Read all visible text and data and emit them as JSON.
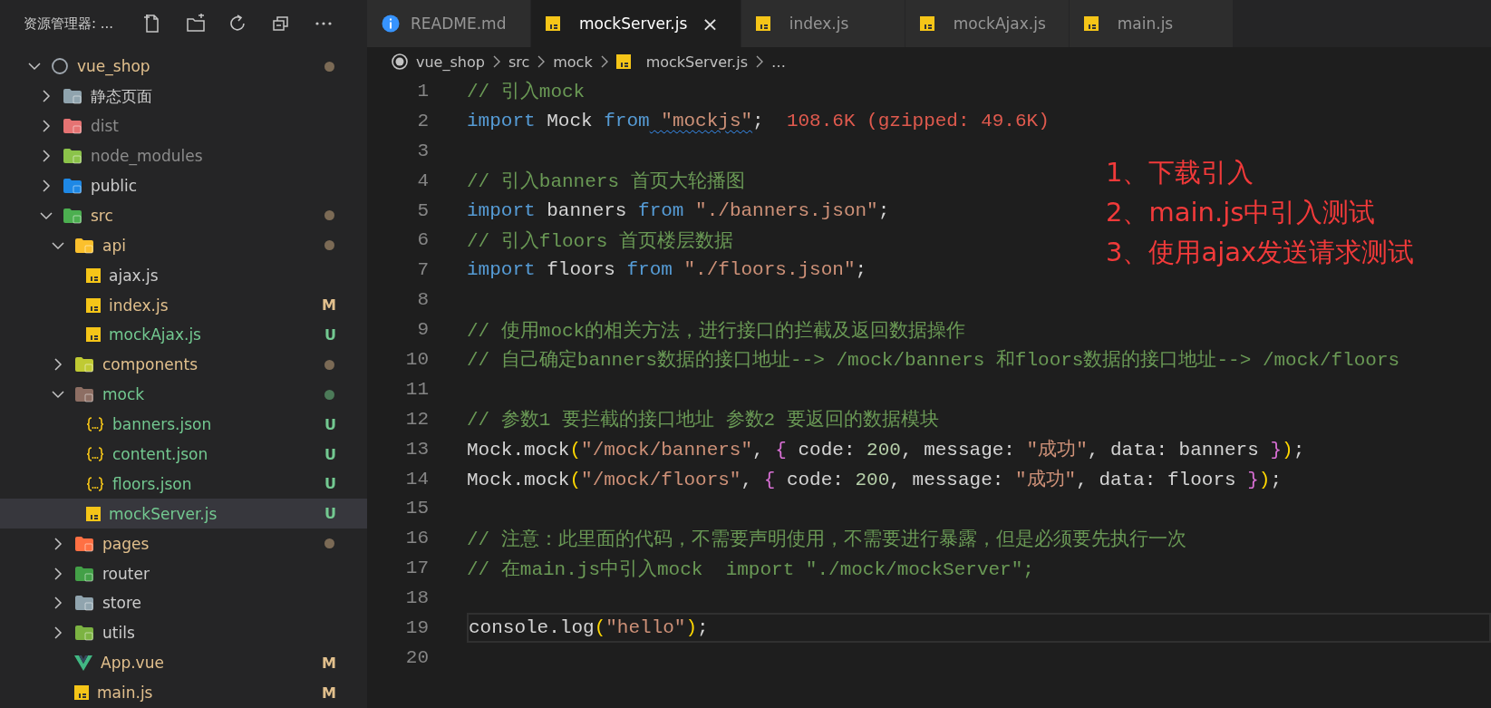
{
  "sidebar": {
    "title": "资源管理器: ...",
    "tree": [
      {
        "name": "vue_shop",
        "kind": "repo",
        "expanded": true,
        "selected": false,
        "modified": true,
        "untracked": false,
        "ignored": false,
        "children": [
          {
            "name": "静态页面",
            "kind": "folder",
            "color": "#90a4ae",
            "expanded": false,
            "selected": false,
            "modified": false,
            "untracked": false,
            "ignored": false
          },
          {
            "name": "dist",
            "kind": "folder",
            "color": "#e57373",
            "expanded": false,
            "selected": false,
            "modified": false,
            "untracked": false,
            "ignored": true
          },
          {
            "name": "node_modules",
            "kind": "folder",
            "color": "#8bc34a",
            "expanded": false,
            "selected": false,
            "modified": false,
            "untracked": false,
            "ignored": true
          },
          {
            "name": "public",
            "kind": "folder",
            "color": "#1e88e5",
            "expanded": false,
            "selected": false,
            "modified": false,
            "untracked": false,
            "ignored": false
          },
          {
            "name": "src",
            "kind": "folder",
            "color": "#4caf50",
            "expanded": true,
            "selected": false,
            "modified": true,
            "untracked": false,
            "ignored": false,
            "children": [
              {
                "name": "api",
                "kind": "folder",
                "color": "#fbc02d",
                "expanded": true,
                "selected": false,
                "modified": true,
                "untracked": false,
                "ignored": false,
                "children": [
                  {
                    "name": "ajax.js",
                    "kind": "js",
                    "selected": false,
                    "modified": false,
                    "untracked": false,
                    "ignored": false
                  },
                  {
                    "name": "index.js",
                    "kind": "js",
                    "selected": false,
                    "modified": true,
                    "untracked": false,
                    "ignored": false,
                    "badge": "M"
                  },
                  {
                    "name": "mockAjax.js",
                    "kind": "js",
                    "selected": false,
                    "modified": false,
                    "untracked": true,
                    "ignored": false,
                    "badge": "U"
                  }
                ]
              },
              {
                "name": "components",
                "kind": "folder",
                "color": "#c0ca33",
                "expanded": false,
                "selected": false,
                "modified": true,
                "untracked": false,
                "ignored": false
              },
              {
                "name": "mock",
                "kind": "folder",
                "color": "#8d6e63",
                "expanded": true,
                "selected": false,
                "modified": false,
                "untracked": true,
                "ignored": false,
                "children": [
                  {
                    "name": "banners.json",
                    "kind": "json",
                    "selected": false,
                    "modified": false,
                    "untracked": true,
                    "ignored": false,
                    "badge": "U"
                  },
                  {
                    "name": "content.json",
                    "kind": "json",
                    "selected": false,
                    "modified": false,
                    "untracked": true,
                    "ignored": false,
                    "badge": "U"
                  },
                  {
                    "name": "floors.json",
                    "kind": "json",
                    "selected": false,
                    "modified": false,
                    "untracked": true,
                    "ignored": false,
                    "badge": "U"
                  },
                  {
                    "name": "mockServer.js",
                    "kind": "js",
                    "selected": true,
                    "modified": false,
                    "untracked": true,
                    "ignored": false,
                    "badge": "U"
                  }
                ]
              },
              {
                "name": "pages",
                "kind": "folder",
                "color": "#ff7043",
                "expanded": false,
                "selected": false,
                "modified": true,
                "untracked": false,
                "ignored": false
              },
              {
                "name": "router",
                "kind": "folder",
                "color": "#43a047",
                "expanded": false,
                "selected": false,
                "modified": false,
                "untracked": false,
                "ignored": false
              },
              {
                "name": "store",
                "kind": "folder",
                "color": "#90a4ae",
                "expanded": false,
                "selected": false,
                "modified": false,
                "untracked": false,
                "ignored": false
              },
              {
                "name": "utils",
                "kind": "folder",
                "color": "#7cb342",
                "expanded": false,
                "selected": false,
                "modified": false,
                "untracked": false,
                "ignored": false
              },
              {
                "name": "App.vue",
                "kind": "vue",
                "selected": false,
                "modified": true,
                "untracked": false,
                "ignored": false,
                "badge": "M"
              },
              {
                "name": "main.js",
                "kind": "js",
                "selected": false,
                "modified": true,
                "untracked": false,
                "ignored": false,
                "badge": "M"
              }
            ]
          }
        ]
      }
    ]
  },
  "tabs": [
    {
      "label": "README.md",
      "kind": "info",
      "selected": false
    },
    {
      "label": "mockServer.js",
      "kind": "js",
      "selected": true,
      "close": "×"
    },
    {
      "label": "index.js",
      "kind": "js",
      "selected": false
    },
    {
      "label": "mockAjax.js",
      "kind": "js",
      "selected": false
    },
    {
      "label": "main.js",
      "kind": "js",
      "selected": false
    }
  ],
  "breadcrumb": [
    {
      "label": "vue_shop",
      "kind": "repo"
    },
    {
      "label": "src",
      "kind": "folder"
    },
    {
      "label": "mock",
      "kind": "folder"
    },
    {
      "label": "mockServer.js",
      "kind": "js"
    },
    {
      "label": "…",
      "kind": "more"
    }
  ],
  "code": [
    {
      "number": "1",
      "tokens": [
        {
          "text": "// 引入mock",
          "kind": "comment"
        }
      ]
    },
    {
      "number": "2",
      "tokens": [
        {
          "text": "import",
          "kind": "keyword"
        },
        {
          "text": " Mock ",
          "kind": "plain"
        },
        {
          "text": "from",
          "kind": "keyword"
        },
        {
          "text": " \"mockjs\"",
          "kind": "string",
          "squiggle": true
        },
        {
          "text": ";",
          "kind": "plain"
        },
        {
          "text": "  108.6K (gzipped: 49.6K)",
          "kind": "hint"
        }
      ]
    },
    {
      "number": "3"
    },
    {
      "number": "4",
      "tokens": [
        {
          "text": "// 引入banners 首页大轮播图",
          "kind": "comment"
        }
      ]
    },
    {
      "number": "5",
      "tokens": [
        {
          "text": "import",
          "kind": "keyword"
        },
        {
          "text": " banners ",
          "kind": "plain"
        },
        {
          "text": "from",
          "kind": "keyword"
        },
        {
          "text": " \"./banners.json\"",
          "kind": "string"
        },
        {
          "text": ";",
          "kind": "plain"
        }
      ]
    },
    {
      "number": "6",
      "tokens": [
        {
          "text": "// 引入floors 首页楼层数据",
          "kind": "comment"
        }
      ]
    },
    {
      "number": "7",
      "tokens": [
        {
          "text": "import",
          "kind": "keyword"
        },
        {
          "text": " floors ",
          "kind": "plain"
        },
        {
          "text": "from",
          "kind": "keyword"
        },
        {
          "text": " \"./floors.json\"",
          "kind": "string"
        },
        {
          "text": ";",
          "kind": "plain"
        }
      ]
    },
    {
      "number": "8"
    },
    {
      "number": "9",
      "tokens": [
        {
          "text": "// 使用mock的相关方法，进行接口的拦截及返回数据操作",
          "kind": "comment"
        }
      ]
    },
    {
      "number": "10",
      "tokens": [
        {
          "text": "// 自己确定banners数据的接口地址--> /mock/banners 和floors数据的接口地址--> /mock/floors",
          "kind": "comment"
        }
      ]
    },
    {
      "number": "11"
    },
    {
      "number": "12",
      "tokens": [
        {
          "text": "// 参数1 要拦截的接口地址 参数2 要返回的数据模块",
          "kind": "comment"
        }
      ]
    },
    {
      "number": "13",
      "tokens": [
        {
          "text": "Mock.mock",
          "kind": "plain"
        },
        {
          "text": "(",
          "kind": "bracket"
        },
        {
          "text": "\"/mock/banners\"",
          "kind": "string"
        },
        {
          "text": ", ",
          "kind": "plain"
        },
        {
          "text": "{",
          "kind": "brace"
        },
        {
          "text": " code: ",
          "kind": "plain"
        },
        {
          "text": "200",
          "kind": "number"
        },
        {
          "text": ", message: ",
          "kind": "plain"
        },
        {
          "text": "\"成功\"",
          "kind": "string"
        },
        {
          "text": ", data: banners ",
          "kind": "plain"
        },
        {
          "text": "}",
          "kind": "brace"
        },
        {
          "text": ")",
          "kind": "bracket"
        },
        {
          "text": ";",
          "kind": "plain"
        }
      ]
    },
    {
      "number": "14",
      "tokens": [
        {
          "text": "Mock.mock",
          "kind": "plain"
        },
        {
          "text": "(",
          "kind": "bracket"
        },
        {
          "text": "\"/mock/floors\"",
          "kind": "string"
        },
        {
          "text": ", ",
          "kind": "plain"
        },
        {
          "text": "{",
          "kind": "brace"
        },
        {
          "text": " code: ",
          "kind": "plain"
        },
        {
          "text": "200",
          "kind": "number"
        },
        {
          "text": ", message: ",
          "kind": "plain"
        },
        {
          "text": "\"成功\"",
          "kind": "string"
        },
        {
          "text": ", data: floors ",
          "kind": "plain"
        },
        {
          "text": "}",
          "kind": "brace"
        },
        {
          "text": ")",
          "kind": "bracket"
        },
        {
          "text": ";",
          "kind": "plain"
        }
      ]
    },
    {
      "number": "15"
    },
    {
      "number": "16",
      "tokens": [
        {
          "text": "// 注意：此里面的代码，不需要声明使用，不需要进行暴露，但是必须要先执行一次",
          "kind": "comment"
        }
      ]
    },
    {
      "number": "17",
      "tokens": [
        {
          "text": "// 在main.js中引入mock  import \"./mock/mockServer\";",
          "kind": "comment"
        }
      ]
    },
    {
      "number": "18"
    },
    {
      "number": "19",
      "current": true,
      "tokens": [
        {
          "text": "console.log",
          "kind": "plain"
        },
        {
          "text": "(",
          "kind": "bracket"
        },
        {
          "text": "\"hello\"",
          "kind": "string"
        },
        {
          "text": ")",
          "kind": "bracket"
        },
        {
          "text": ";",
          "kind": "plain"
        }
      ]
    },
    {
      "number": "20"
    }
  ],
  "annotations": [
    "1、下载引入",
    "2、main.js中引入测试",
    "3、使用ajax发送请求测试"
  ]
}
